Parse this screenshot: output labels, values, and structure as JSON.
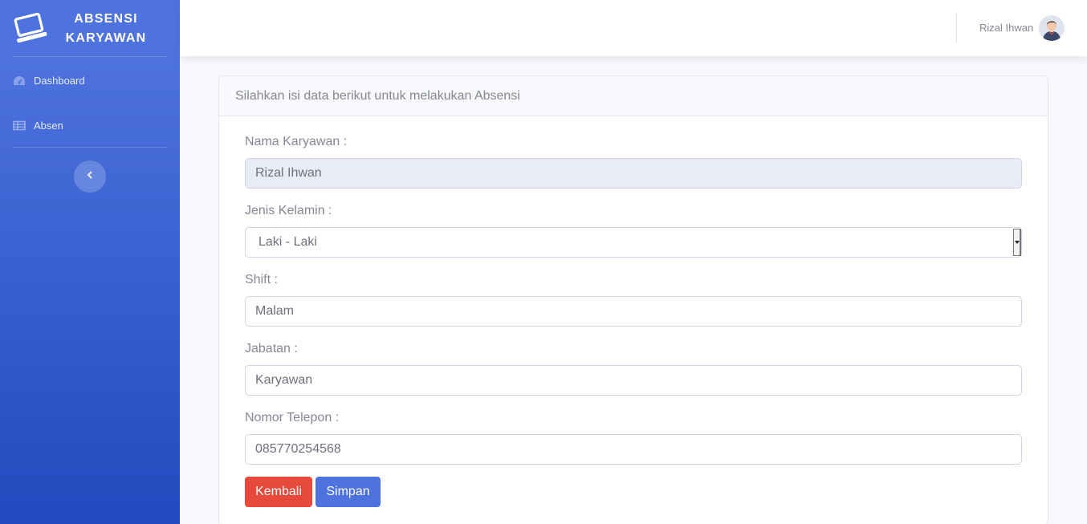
{
  "brand": {
    "line1": "ABSENSI",
    "line2": "KARYAWAN",
    "icon": "laptop-icon"
  },
  "sidebar": {
    "items": [
      {
        "label": "Dashboard",
        "icon": "tachometer-icon"
      },
      {
        "label": "Absen",
        "icon": "table-icon"
      }
    ],
    "toggle_icon": "chevron-left-icon"
  },
  "topbar": {
    "user_name": "Rizal Ihwan",
    "avatar_icon": "user-avatar"
  },
  "card": {
    "header": "Silahkan isi data berikut untuk melakukan Absensi",
    "fields": {
      "nama": {
        "label": "Nama Karyawan :",
        "value": "Rizal Ihwan"
      },
      "jenis_kelamin": {
        "label": "Jenis Kelamin :",
        "value": "Laki - Laki"
      },
      "shift": {
        "label": "Shift :",
        "value": "Malam"
      },
      "jabatan": {
        "label": "Jabatan :",
        "value": "Karyawan"
      },
      "telepon": {
        "label": "Nomor Telepon :",
        "value": "085770254568"
      }
    },
    "buttons": {
      "back": "Kembali",
      "save": "Simpan"
    }
  },
  "colors": {
    "primary": "#4e73df",
    "primary_dark": "#224abe",
    "danger": "#e74a3b",
    "text_muted": "#858796"
  }
}
